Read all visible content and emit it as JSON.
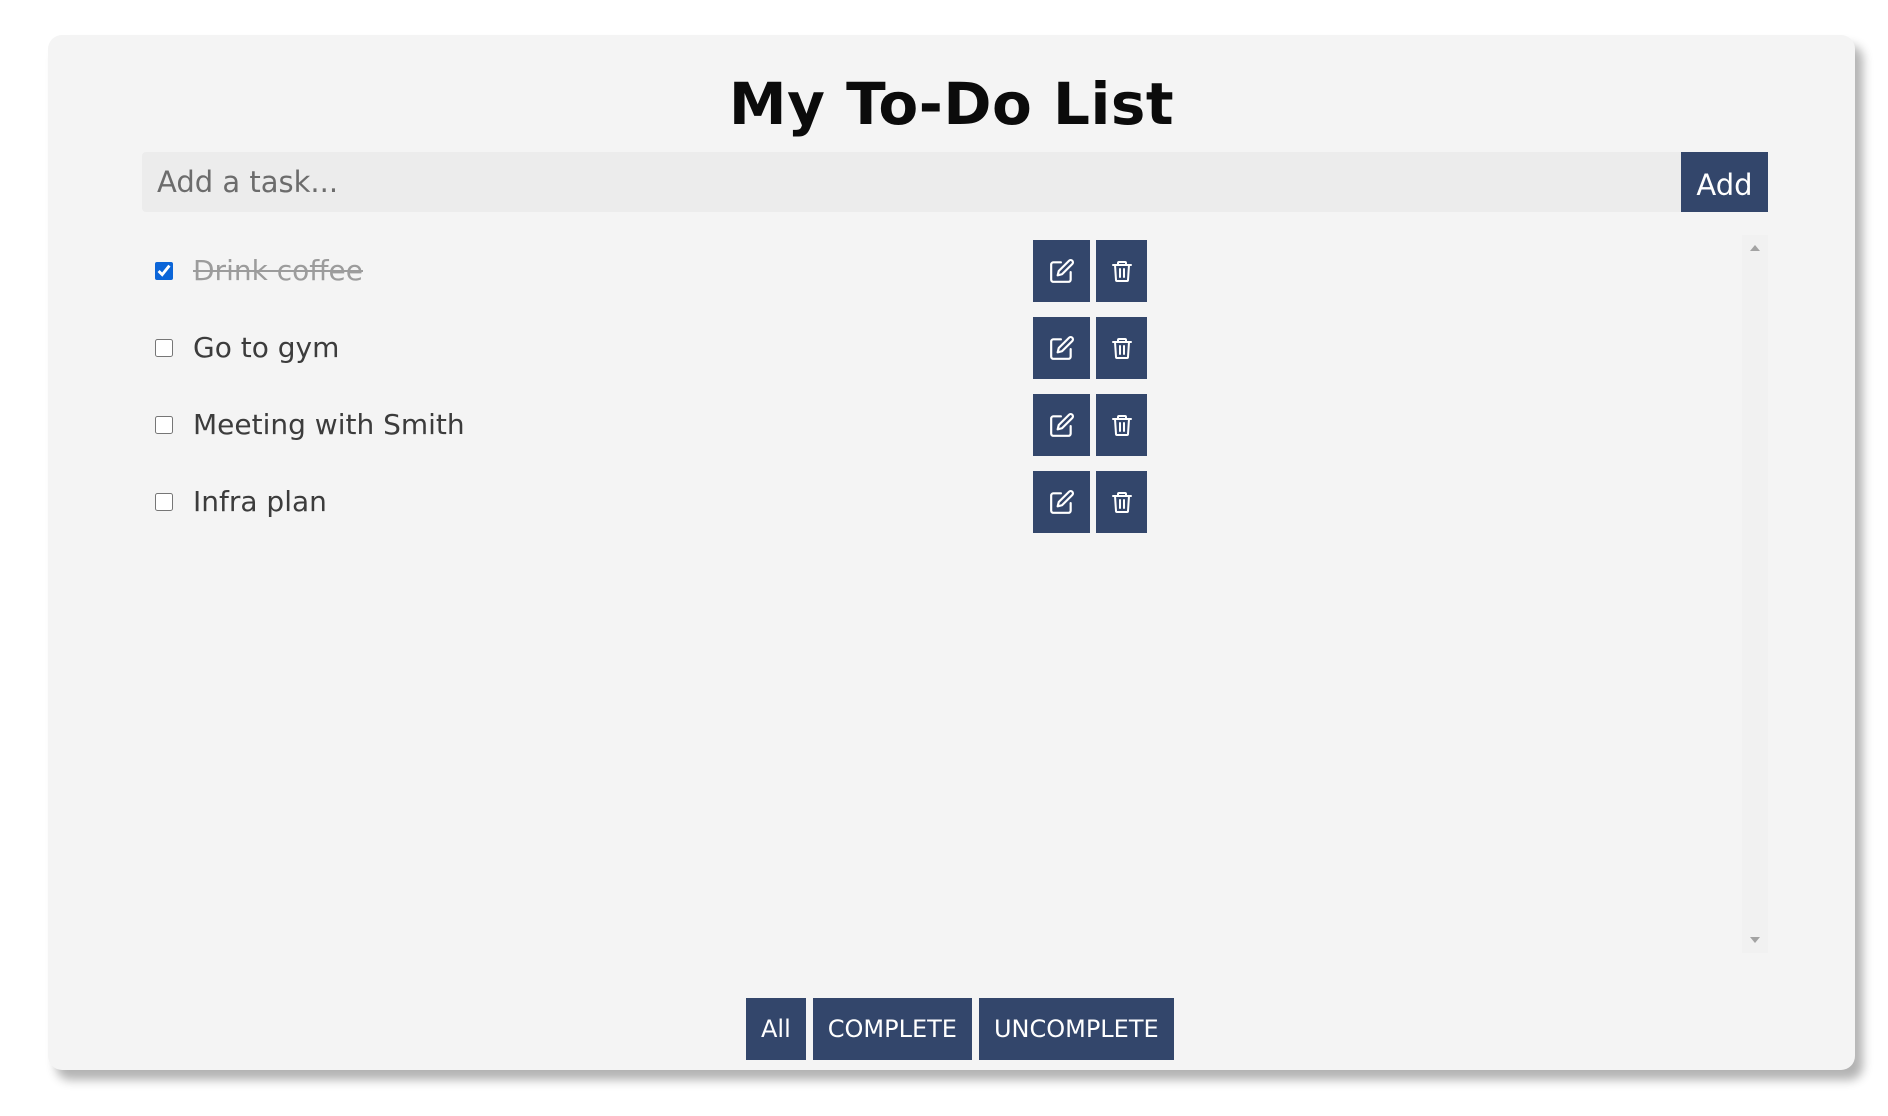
{
  "app": {
    "title": "My To-Do List"
  },
  "add_task": {
    "placeholder": "Add a task...",
    "value": "",
    "button_label": "Add"
  },
  "tasks": [
    {
      "label": "Drink coffee",
      "completed": true
    },
    {
      "label": "Go to gym",
      "completed": false
    },
    {
      "label": "Meeting with Smith",
      "completed": false
    },
    {
      "label": "Infra plan",
      "completed": false
    }
  ],
  "task_actions": {
    "edit_icon": "edit-icon",
    "delete_icon": "trash-icon"
  },
  "filters": {
    "all": "All",
    "complete": "COMPLETE",
    "uncomplete": "UNCOMPLETE"
  },
  "colors": {
    "card_background": "#f4f4f4",
    "button_background": "#33466b",
    "button_text": "#ffffff",
    "checkbox_accent": "#0b65d8",
    "completed_text": "#9c9c9c"
  }
}
